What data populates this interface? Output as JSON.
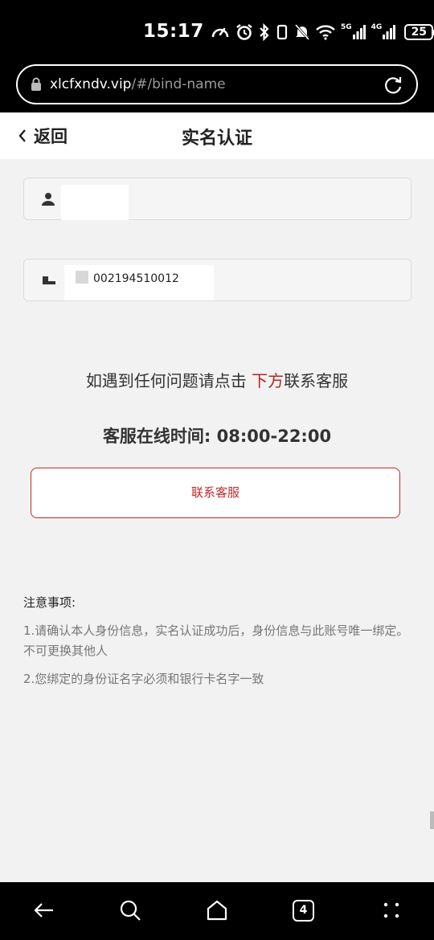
{
  "status_bar": {
    "time": "15:17",
    "battery": "25",
    "network_1": "5G",
    "network_2": "4G",
    "icons": [
      "speed-icon",
      "alarm-icon",
      "bluetooth-icon",
      "vibrate-icon",
      "mute-icon",
      "wifi-icon",
      "signal-icon",
      "signal-icon",
      "battery-icon"
    ]
  },
  "browser": {
    "url_host": "xlcfxndv.vip",
    "url_path": "/#/bind-name",
    "icons": [
      "lock-icon",
      "reload-icon"
    ]
  },
  "header": {
    "back_label": "返回",
    "title": "实名认证"
  },
  "form": {
    "name_value": "",
    "id_value_visible": "002194510012",
    "icons": [
      "user-icon",
      "id-card-icon"
    ]
  },
  "help": {
    "text_before": "如遇到任何问题请点击 ",
    "text_accent": "下方",
    "text_after": "联系客服",
    "service_time": "客服在线时间: 08:00-22:00",
    "contact_button": "联系客服"
  },
  "notes": {
    "title": "注意事项:",
    "items": [
      "1.请确认本人身份信息，实名认证成功后，身份信息与此账号唯一绑定。不可更换其他人",
      "2.您绑定的身份证名字必须和银行卡名字一致"
    ]
  },
  "bottom_nav": {
    "tab_count": "4",
    "icons": [
      "back-arrow-icon",
      "search-icon",
      "home-icon",
      "tabs-icon",
      "menu-icon"
    ]
  },
  "colors": {
    "accent": "#c62828",
    "background": "#f2f2f2"
  }
}
